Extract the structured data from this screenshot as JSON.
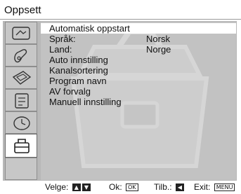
{
  "title": "Oppsett",
  "sidebar": [
    {
      "icon": "picture-adjust-icon",
      "active": false
    },
    {
      "icon": "sound-adjust-icon",
      "active": false
    },
    {
      "icon": "screen-control-icon",
      "active": false
    },
    {
      "icon": "features-icon",
      "active": false
    },
    {
      "icon": "timer-icon",
      "active": false
    },
    {
      "icon": "setup-toolbox-icon",
      "active": true
    },
    {
      "icon": "empty-tab",
      "active": false
    }
  ],
  "menu": [
    {
      "label": "Automatisk oppstart",
      "value": "",
      "selected": true
    },
    {
      "label": "Språk:",
      "value": "Norsk",
      "selected": false
    },
    {
      "label": "Land:",
      "value": "Norge",
      "selected": false
    },
    {
      "label": "Auto innstilling",
      "value": "",
      "selected": false
    },
    {
      "label": "Kanalsortering",
      "value": "",
      "selected": false
    },
    {
      "label": "Program navn",
      "value": "",
      "selected": false
    },
    {
      "label": "AV forvalg",
      "value": "",
      "selected": false
    },
    {
      "label": "Manuell innstilling",
      "value": "",
      "selected": false
    }
  ],
  "footer": {
    "select_label": "Velge:",
    "select_keys": [
      "▲",
      "▼"
    ],
    "ok_label": "Ok:",
    "ok_key": "OK",
    "back_label": "Tilb.:",
    "back_key": "◀",
    "exit_label": "Exit:",
    "exit_key": "MENU"
  },
  "colors": {
    "frame": "#b8b8b8",
    "panel": "#c2c2c2",
    "highlight": "#ffffff"
  }
}
